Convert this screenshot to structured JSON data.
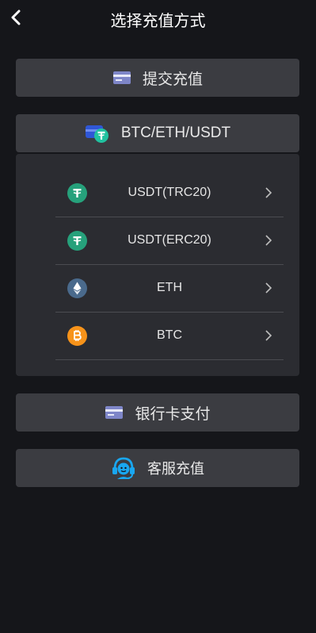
{
  "header": {
    "title": "选择充值方式"
  },
  "buttons": {
    "submit_recharge": "提交充值",
    "crypto": "BTC/ETH/USDT",
    "bank_card": "银行卡支付",
    "customer_service": "客服充值"
  },
  "crypto_list": [
    {
      "label": "USDT(TRC20)",
      "icon": "tether-icon",
      "color": "#26a17b"
    },
    {
      "label": "USDT(ERC20)",
      "icon": "tether-icon",
      "color": "#26a17b"
    },
    {
      "label": "ETH",
      "icon": "ethereum-icon",
      "color": "#4a6a8c"
    },
    {
      "label": "BTC",
      "icon": "bitcoin-icon",
      "color": "#f7931a"
    }
  ],
  "colors": {
    "background": "#15161a",
    "button": "#3b3c41",
    "panel": "#2b2c31"
  }
}
